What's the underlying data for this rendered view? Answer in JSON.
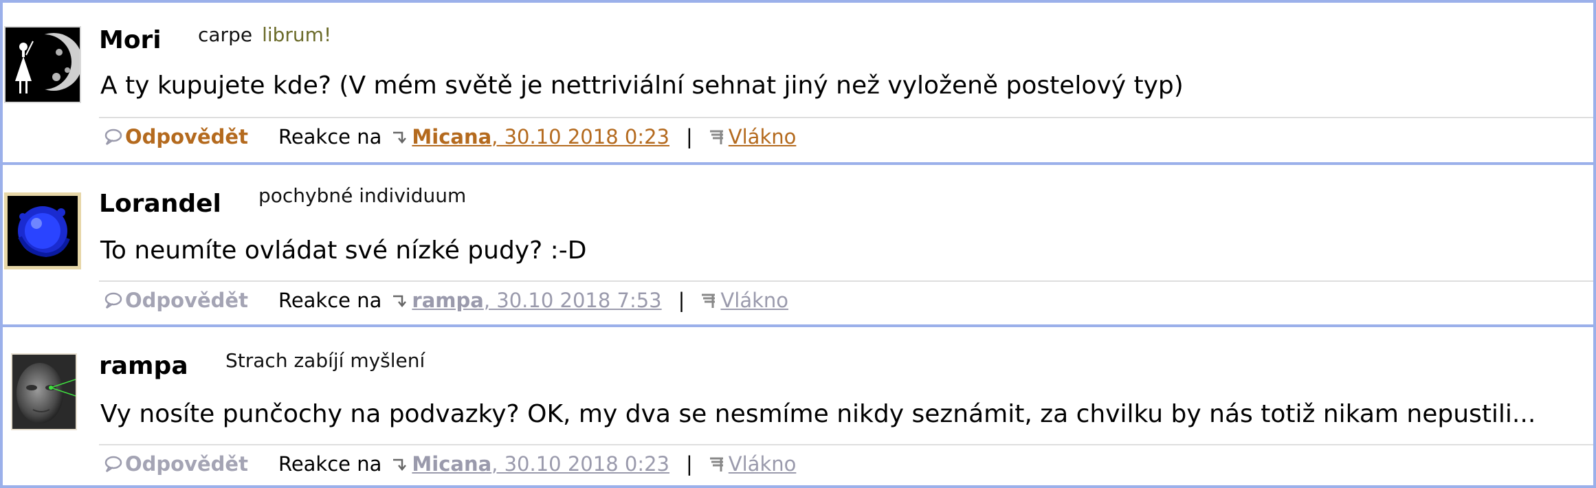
{
  "posts": [
    {
      "username": "Mori",
      "tagline": "carpe",
      "tagline_accent": "librum!",
      "message": "A ty kupujete kde? (V mém světě je nettriviální sehnat jiný než vyloženě postelový typ)",
      "reply_label": "Odpovědět",
      "reaction_label": "Reakce na",
      "ref_user": "Micana",
      "ref_date": ", 30.10 2018 0:23",
      "thread_label": "Vlákno",
      "avatar_icon": "lady-moon-avatar",
      "link_color": "#b46a1e"
    },
    {
      "username": "Lorandel",
      "tagline": "pochybné individuum",
      "message": "To neumíte ovládat své nízké pudy? :-D",
      "reply_label": "Odpovědět",
      "reaction_label": "Reakce na",
      "ref_user": "rampa",
      "ref_date": ", 30.10 2018 7:53",
      "thread_label": "Vlákno",
      "avatar_icon": "blue-orb-avatar",
      "link_color": "#9a9aac"
    },
    {
      "username": "rampa",
      "tagline": "Strach zabíjí myšlení",
      "message": "Vy nosíte punčochy na podvazky? OK, my dva se nesmíme nikdy seznámit, za chvilku by nás totiž nikam nepustili...",
      "reply_label": "Odpovědět",
      "reaction_label": "Reakce na",
      "ref_user": "Micana",
      "ref_date": ", 30.10 2018 0:23",
      "thread_label": "Vlákno",
      "avatar_icon": "face-avatar",
      "link_color": "#9a9aac"
    }
  ],
  "separator": "|",
  "colors": {
    "border": "#9bb0ea",
    "active_link": "#b46a1e",
    "inactive_link": "#9a9aac"
  }
}
